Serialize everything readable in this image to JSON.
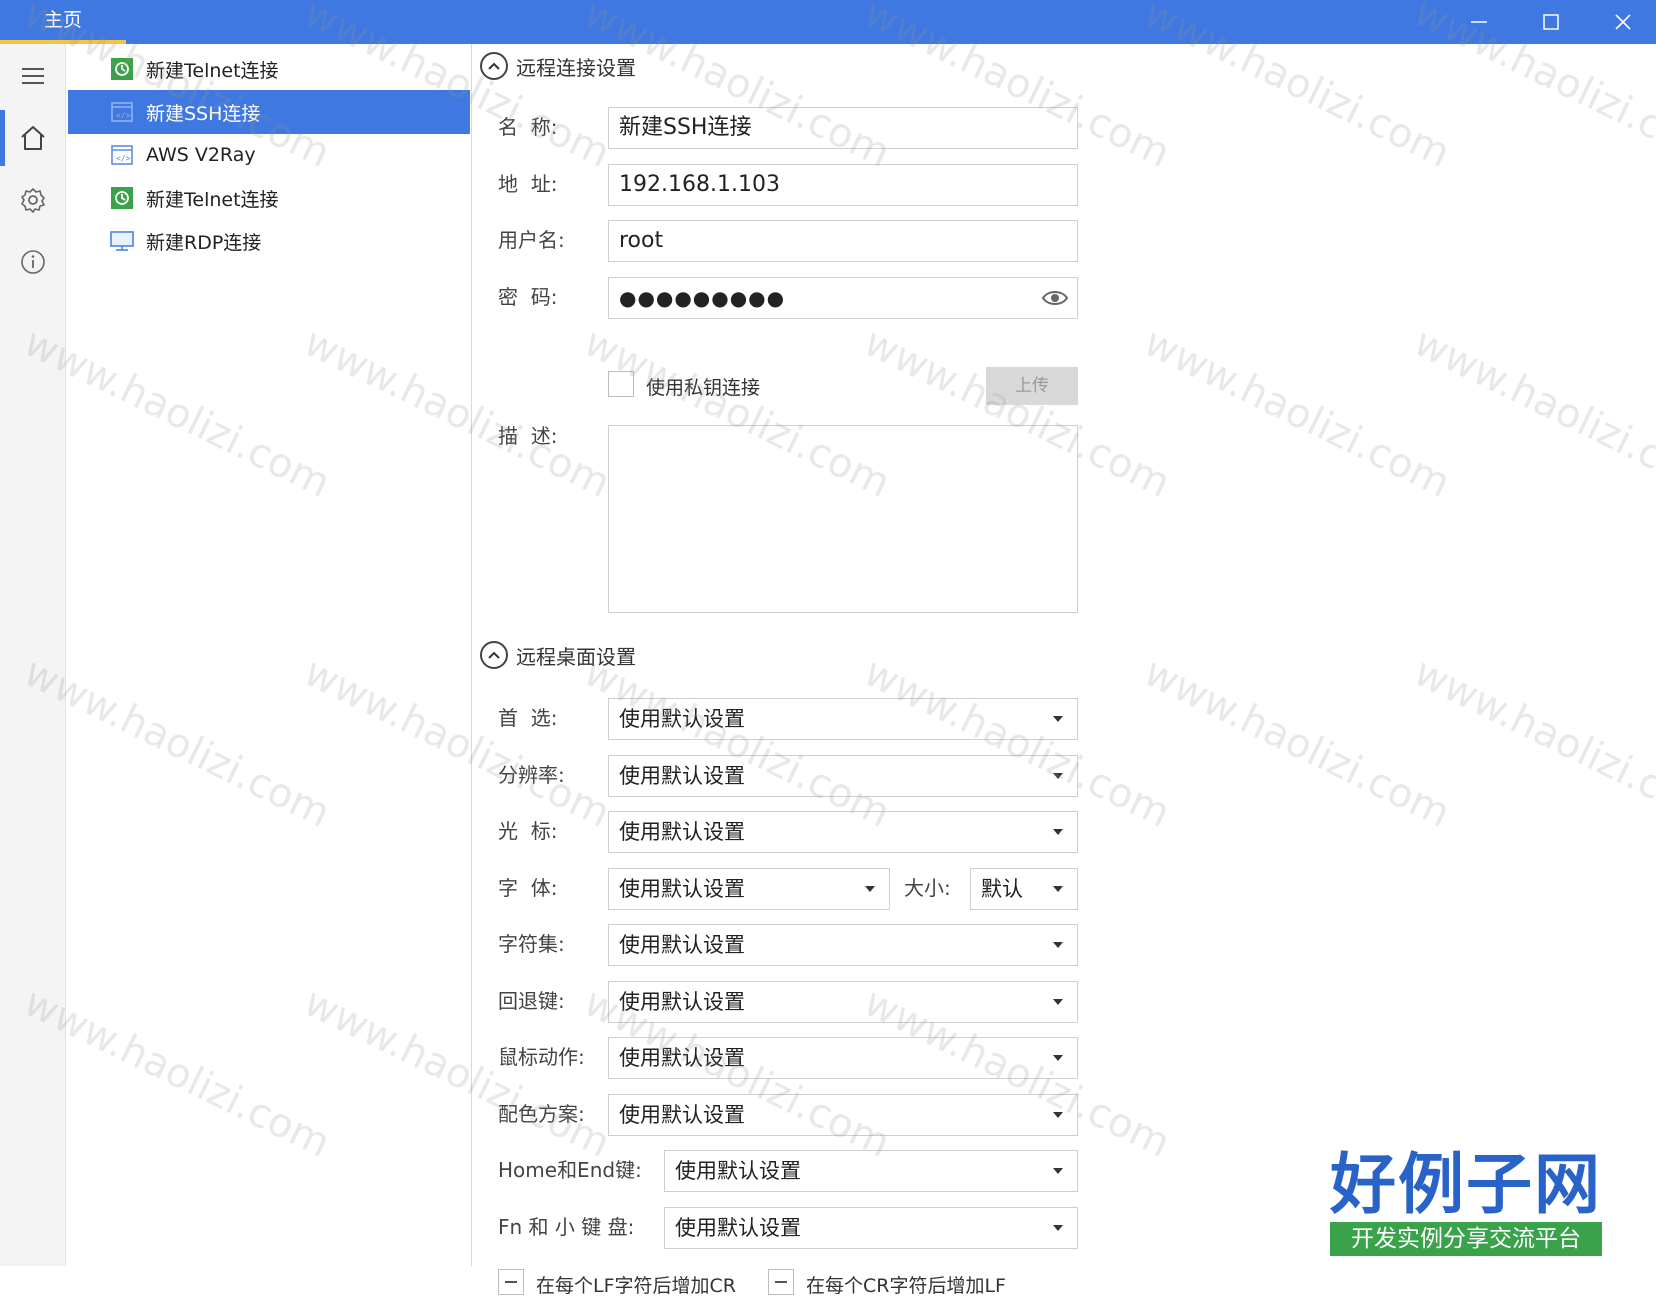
{
  "window": {
    "tab_title": "主页",
    "minimize_icon": "minimize-icon",
    "maximize_icon": "maximize-icon",
    "close_icon": "close-icon"
  },
  "rail": {
    "items": [
      {
        "icon": "menu-icon"
      },
      {
        "icon": "home-icon",
        "active": true
      },
      {
        "icon": "settings-icon"
      },
      {
        "icon": "info-icon"
      }
    ]
  },
  "connections": [
    {
      "label": "新建Telnet连接",
      "icon": "telnet-icon"
    },
    {
      "label": "新建SSH连接",
      "icon": "ssh-icon",
      "selected": true
    },
    {
      "label": "AWS V2Ray",
      "icon": "ssh-icon"
    },
    {
      "label": "新建Telnet连接",
      "icon": "telnet-icon"
    },
    {
      "label": "新建RDP连接",
      "icon": "rdp-icon"
    }
  ],
  "remote_conn": {
    "heading": "远程连接设置",
    "name_label": "名  称:",
    "name_value": "新建SSH连接",
    "addr_label": "地  址:",
    "addr_value": "192.168.1.103",
    "user_label": "用户名:",
    "user_value": "root",
    "pwd_label": "密  码:",
    "pwd_value": "●●●●●●●●●",
    "key_checkbox_label": "使用私钥连接",
    "upload_label": "上传",
    "desc_label": "描  述:"
  },
  "desktop": {
    "heading": "远程桌面设置",
    "pref_label": "首  选:",
    "res_label": "分辨率:",
    "cursor_label": "光  标:",
    "font_label": "字  体:",
    "size_label": "大小:",
    "size_value": "默认",
    "charset_label": "字符集:",
    "backspace_label": "回退键:",
    "mouse_label": "鼠标动作:",
    "color_label": "配色方案:",
    "homeend_label": "Home和End键:",
    "fn_label": "Fn 和 小 键 盘:",
    "default_value": "使用默认设置",
    "lf_cr_label": "在每个LF字符后增加CR",
    "cr_lf_label": "在每个CR字符后增加LF"
  },
  "watermark": "www.haolizi.com",
  "brand": {
    "title": "好例子网",
    "subtitle": "开发实例分享交流平台"
  },
  "colors": {
    "accent": "#3f78e0",
    "highlight": "#f5c542",
    "logo_blue": "#2a63c8",
    "logo_green": "#3aa24a"
  }
}
